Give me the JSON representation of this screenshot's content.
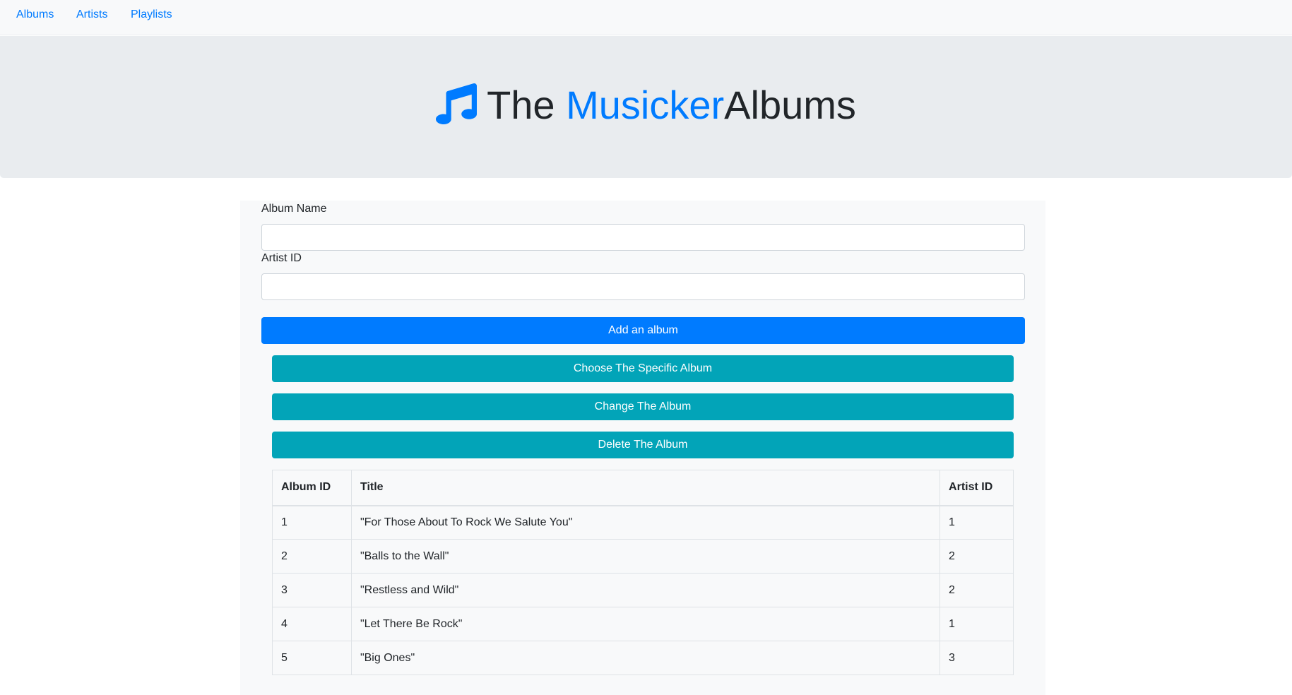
{
  "nav": {
    "albums": "Albums",
    "artists": "Artists",
    "playlists": "Playlists"
  },
  "hero": {
    "icon": "music-note-icon",
    "title_prefix": "The ",
    "title_brand": "Musicker",
    "title_suffix": "Albums"
  },
  "form": {
    "album_name_label": "Album Name",
    "album_name_value": "",
    "artist_id_label": "Artist ID",
    "artist_id_value": "",
    "add_button": "Add an album",
    "choose_button": "Choose The Specific Album",
    "change_button": "Change The Album",
    "delete_button": "Delete The Album"
  },
  "table": {
    "headers": [
      "Album ID",
      "Title",
      "Artist ID"
    ],
    "rows": [
      [
        "1",
        "\"For Those About To Rock We Salute You\"",
        "1"
      ],
      [
        "2",
        "\"Balls to the Wall\"",
        "2"
      ],
      [
        "3",
        "\"Restless and Wild\"",
        "2"
      ],
      [
        "4",
        "\"Let There Be Rock\"",
        "1"
      ],
      [
        "5",
        "\"Big Ones\"",
        "3"
      ]
    ]
  },
  "colors": {
    "primary": "#007bff",
    "info": "#02a4b8",
    "hero_bg": "#e9ecef",
    "nav_bg": "#f8f9fa"
  }
}
